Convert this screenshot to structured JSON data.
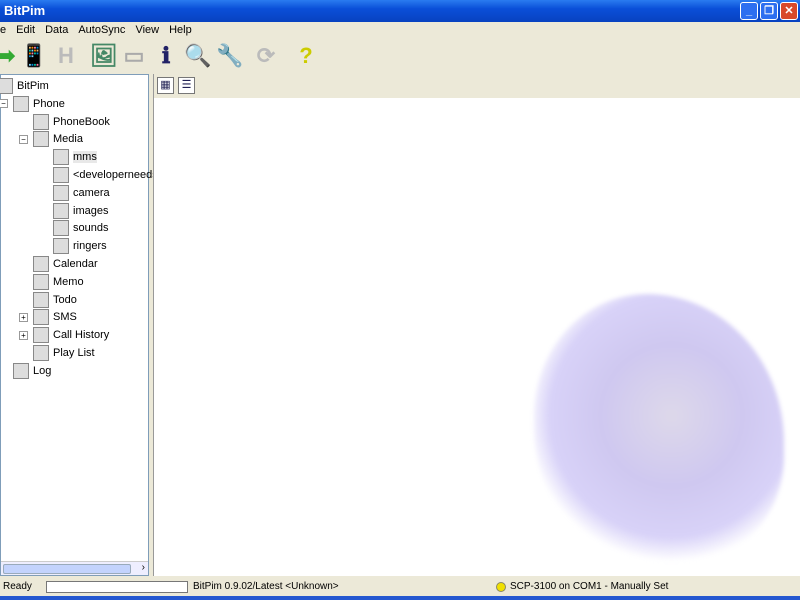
{
  "window": {
    "title": "BitPim"
  },
  "menu": [
    "e",
    "Edit",
    "Data",
    "AutoSync",
    "View",
    "Help"
  ],
  "toolbar": [
    {
      "icon": "arrow-right-icon",
      "glyph": "➡"
    },
    {
      "icon": "phone-send-icon",
      "glyph": "📱"
    },
    {
      "icon": "history-icon",
      "glyph": "H"
    },
    {
      "icon": "add-image-icon",
      "glyph": "🖼"
    },
    {
      "icon": "remove-icon",
      "glyph": "▭"
    },
    {
      "icon": "info-icon",
      "glyph": "ℹ"
    },
    {
      "icon": "phone-detect-icon",
      "glyph": "🔍"
    },
    {
      "icon": "tools-icon",
      "glyph": "🔧"
    },
    {
      "icon": "refresh-icon",
      "glyph": "⟳"
    },
    {
      "icon": "help-icon",
      "glyph": "?"
    }
  ],
  "tree": [
    {
      "label": "BitPim",
      "level": 0,
      "icon": "bitpim-icon"
    },
    {
      "label": "Phone",
      "level": 1,
      "icon": "phone-icon",
      "expander": "−"
    },
    {
      "label": "PhoneBook",
      "level": 2,
      "icon": "phonebook-icon"
    },
    {
      "label": "Media",
      "level": 2,
      "icon": "media-icon",
      "expander": "−"
    },
    {
      "label": "mms",
      "level": 3,
      "icon": "monitor-icon",
      "selected": true
    },
    {
      "label": "<developerneedst",
      "level": 3,
      "icon": "monitor-icon"
    },
    {
      "label": "camera",
      "level": 3,
      "icon": "camera-icon"
    },
    {
      "label": "images",
      "level": 3,
      "icon": "monitor-icon"
    },
    {
      "label": "sounds",
      "level": 3,
      "icon": "speaker-icon"
    },
    {
      "label": "ringers",
      "level": 3,
      "icon": "music-note-icon"
    },
    {
      "label": "Calendar",
      "level": 2,
      "icon": "calendar-icon"
    },
    {
      "label": "Memo",
      "level": 2,
      "icon": "memo-icon"
    },
    {
      "label": "Todo",
      "level": 2,
      "icon": "todo-icon"
    },
    {
      "label": "SMS",
      "level": 2,
      "icon": "sms-icon",
      "expander": "+"
    },
    {
      "label": "Call History",
      "level": 2,
      "icon": "call-history-icon",
      "expander": "+"
    },
    {
      "label": "Play List",
      "level": 2,
      "icon": "playlist-icon"
    },
    {
      "label": "Log",
      "level": 1,
      "icon": "log-icon"
    }
  ],
  "status": {
    "ready": "Ready",
    "version": "BitPim 0.9.02/Latest <Unknown>",
    "phone": "SCP-3100 on COM1 - Manually Set",
    "phone_indicator_color": "#f0e000"
  }
}
